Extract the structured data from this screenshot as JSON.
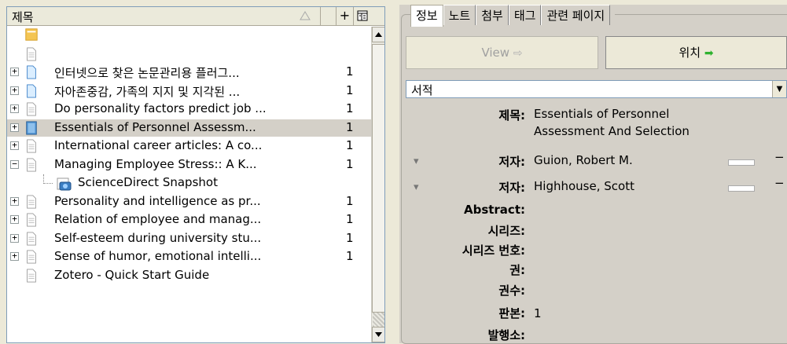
{
  "items_pane": {
    "column_title": "제목",
    "rows": [
      {
        "title": "",
        "count": "",
        "icon": "feed",
        "twisty": ""
      },
      {
        "title": "",
        "count": "",
        "icon": "page",
        "twisty": ""
      },
      {
        "title": "인터넷으로 찾은 논문관리용 플러그...",
        "count": "1",
        "icon": "doc-blue",
        "twisty": "+"
      },
      {
        "title": "자아존중감, 가족의 지지 및 지각된 ...",
        "count": "1",
        "icon": "doc-blue",
        "twisty": "+"
      },
      {
        "title": "Do personality factors predict job ...",
        "count": "1",
        "icon": "page",
        "twisty": "+"
      },
      {
        "title": "Essentials of Personnel Assessm...",
        "count": "1",
        "icon": "book",
        "twisty": "+"
      },
      {
        "title": "International career articles: A co...",
        "count": "1",
        "icon": "page",
        "twisty": "+"
      },
      {
        "title": "Managing Employee Stress:: A K...",
        "count": "1",
        "icon": "page",
        "twisty": "−"
      },
      {
        "title": "Personality and intelligence as pr...",
        "count": "1",
        "icon": "page",
        "twisty": "+"
      },
      {
        "title": "Relation of employee and manag...",
        "count": "1",
        "icon": "page",
        "twisty": "+"
      },
      {
        "title": "Self-esteem during university stu...",
        "count": "1",
        "icon": "page",
        "twisty": "+"
      },
      {
        "title": "Sense of humor, emotional intelli...",
        "count": "1",
        "icon": "page",
        "twisty": "+"
      },
      {
        "title": "Zotero - Quick Start Guide",
        "count": "",
        "icon": "page",
        "twisty": ""
      }
    ],
    "child": {
      "title": "ScienceDirect Snapshot"
    }
  },
  "item_pane": {
    "tabs": [
      "정보",
      "노트",
      "첨부",
      "태그",
      "관련 페이지"
    ],
    "view_button": "View",
    "locate_button": "위치",
    "item_type": "서적",
    "fields": [
      {
        "label": "제목:",
        "value": "Essentials of Personnel"
      },
      {
        "label": "",
        "value": "Assessment And Selection"
      },
      {
        "label": "저자:",
        "value": "Guion,   Robert M."
      },
      {
        "label": "저자:",
        "value": "Highhouse,   Scott"
      },
      {
        "label": "Abstract:",
        "value": ""
      },
      {
        "label": "시리즈:",
        "value": ""
      },
      {
        "label": "시리즈 번호:",
        "value": ""
      },
      {
        "label": "권:",
        "value": ""
      },
      {
        "label": "권수:",
        "value": ""
      },
      {
        "label": "판본:",
        "value": "1"
      },
      {
        "label": "발행소:",
        "value": ""
      }
    ],
    "author_remove": "−"
  }
}
